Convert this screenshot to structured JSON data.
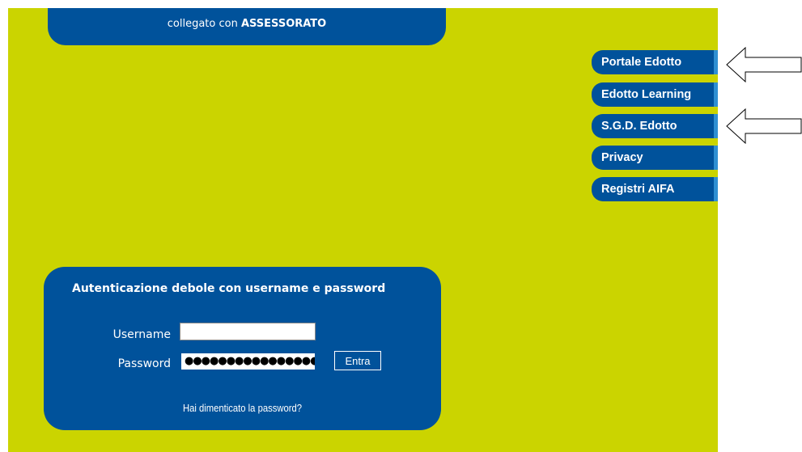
{
  "header": {
    "connected_prefix": "collegato con",
    "connected_entity": "ASSESSORATO"
  },
  "nav": {
    "items": [
      {
        "label": "Portale Edotto"
      },
      {
        "label": "Edotto Learning"
      },
      {
        "label": "S.G.D. Edotto"
      },
      {
        "label": "Privacy"
      },
      {
        "label": "Registri AIFA"
      }
    ],
    "arrow_icon": "left-arrow-icon"
  },
  "login": {
    "title": "Autenticazione debole con username e password",
    "username_label": "Username",
    "username_value": "",
    "password_label": "Password",
    "password_value": "●●●●●●●●●●●●●●●●",
    "submit_label": "Entra",
    "forgot_label": "Hai dimenticato la password?"
  },
  "colors": {
    "background": "#cbd400",
    "panel": "#00529b",
    "nav_accent": "#2f8fd2"
  }
}
